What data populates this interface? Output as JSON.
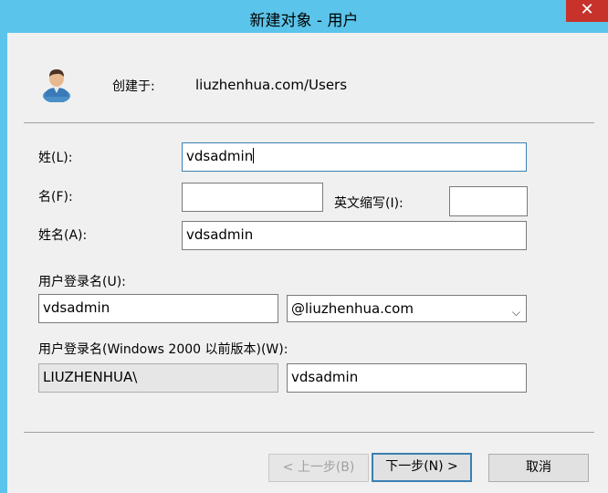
{
  "window": {
    "title": "新建对象 - 用户",
    "close_glyph": "✕"
  },
  "header": {
    "created_in_label": "创建于:",
    "created_in_value": "liuzhenhua.com/Users",
    "icon": "user-icon"
  },
  "form": {
    "last_name": {
      "label": "姓(L):",
      "value": "vdsadmin"
    },
    "first_name": {
      "label": "名(F):",
      "value": ""
    },
    "initials": {
      "label": "英文缩写(I):",
      "value": ""
    },
    "full_name": {
      "label": "姓名(A):",
      "value": "vdsadmin"
    },
    "logon_name": {
      "label": "用户登录名(U):",
      "value": "vdsadmin",
      "domain_selected": "@liuzhenhua.com"
    },
    "logon_name_pre2000": {
      "label": "用户登录名(Windows 2000 以前版本)(W):",
      "domain_prefix": "LIUZHENHUA\\",
      "value": "vdsadmin"
    }
  },
  "buttons": {
    "back": "< 上一步(B)",
    "next": "下一步(N) >",
    "cancel": "取消"
  },
  "colors": {
    "titlebar": "#5bc4ea",
    "close": "#c7322a",
    "dialog_bg": "#f0f0f0",
    "focus_border": "#3c7fb1"
  }
}
